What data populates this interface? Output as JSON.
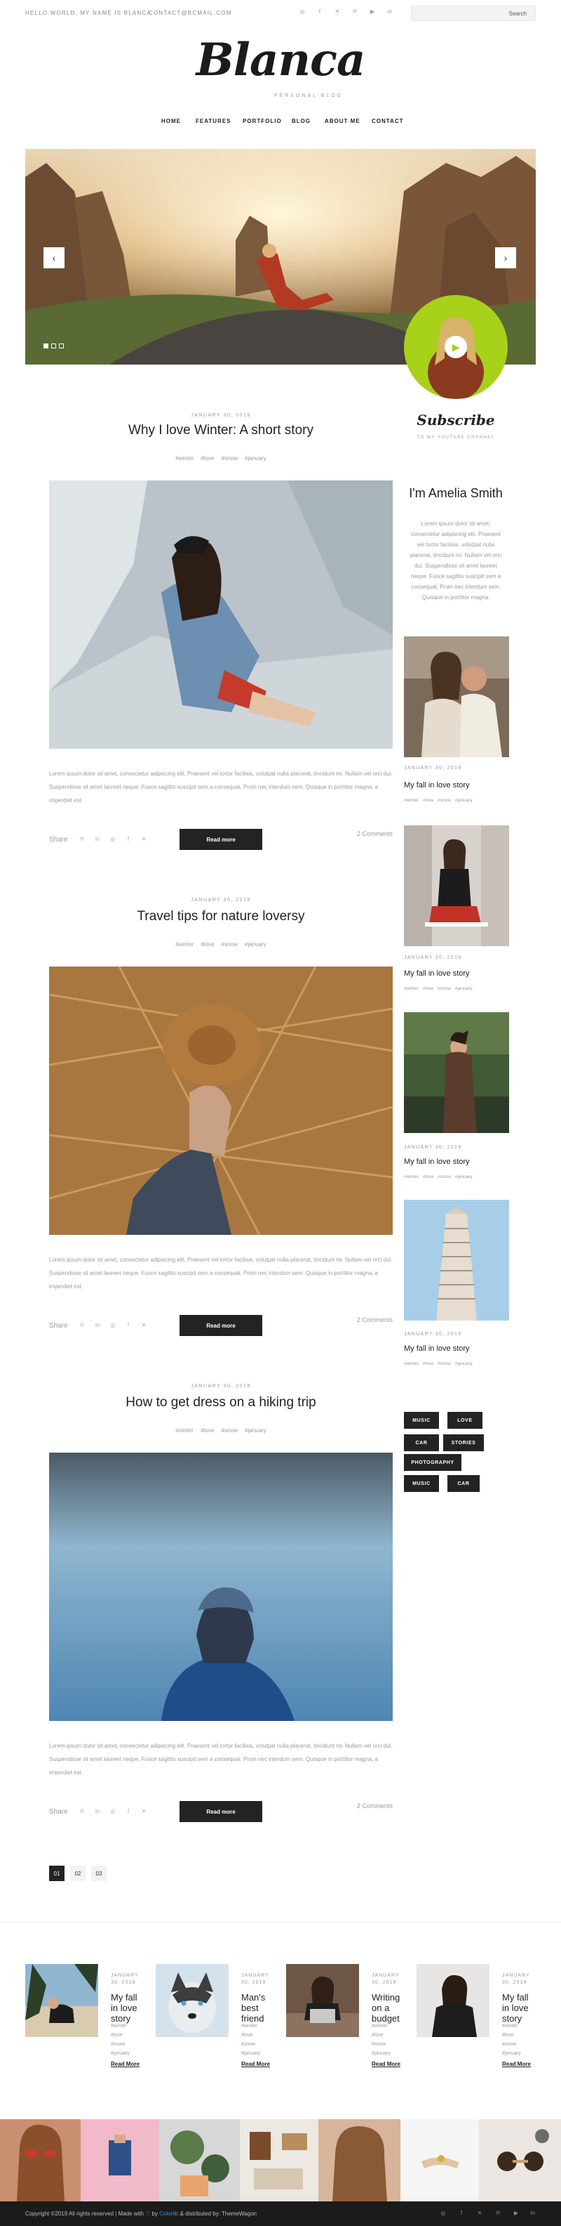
{
  "topbar": {
    "greeting": "HELLO WORLD, MY NAME IS BLANCA",
    "email": "CONTACT@BCMAIL.COM",
    "social": [
      "instagram-icon",
      "facebook-icon",
      "twitter-icon",
      "pinterest-icon",
      "youtube-icon",
      "linkedin-icon"
    ],
    "social_glyphs": [
      "◎",
      "f",
      "✕",
      "℗",
      "▶",
      "in"
    ],
    "search_placeholder": "",
    "search_label": "Search"
  },
  "header": {
    "logo": "Blanca",
    "tagline": "PERSONAL BLOG"
  },
  "nav": [
    "HOME",
    "FEATURES",
    "PORTFOLIO",
    "BLOG",
    "ABOUT ME",
    "CONTACT"
  ],
  "slider": {
    "prev": "‹",
    "next": "›",
    "dots": 3,
    "active_dot": 1
  },
  "posts": [
    {
      "date": "JANUARY 30, 2019",
      "title": "Why I love Winter: A short story",
      "tags": "#winter #love #snow #january",
      "excerpt": "Lorem ipsum dolor sit amet, consectetur adipiscing elit. Praesent vel tortor facilisis, volutpat nulla placerat, tincidunt mi. Nullam vel orci dui. Suspendisse sit amet laoreet neque. Fusce sagittis suscipit sem a consequat. Proin nec interdum sem. Quisque in porttitor magna, a imperdiet est.",
      "share": "Share",
      "read_more": "Read more",
      "comments": "2 Comments"
    },
    {
      "date": "JANUARY 30, 2019",
      "title": "Travel tips for nature loversy",
      "tags": "#winter #love #snow #january",
      "excerpt": "Lorem ipsum dolor sit amet, consectetur adipiscing elit. Praesent vel tortor facilisis, volutpat nulla placerat, tincidunt mi. Nullam vel orci dui. Suspendisse sit amet laoreet neque. Fusce sagittis suscipit sem a consequat. Proin nec interdum sem. Quisque in porttitor magna, a imperdiet est.",
      "share": "Share",
      "read_more": "Read more",
      "comments": "2 Comments"
    },
    {
      "date": "JANUARY 30, 2019",
      "title": "How to get dress on a hiking trip",
      "tags": "#winter #love #snow #january",
      "excerpt": "Lorem ipsum dolor sit amet, consectetur adipiscing elit. Praesent vel tortor facilisis, volutpat nulla placerat, tincidunt mi. Nullam vel orci dui. Suspendisse sit amet laoreet neque. Fusce sagittis suscipit sem a consequat. Proin nec interdum sem. Quisque in porttitor magna, a imperdiet est.",
      "share": "Share",
      "read_more": "Read more",
      "comments": "2 Comments"
    }
  ],
  "share_icons": [
    "pinterest-icon",
    "linkedin-icon",
    "instagram-icon",
    "facebook-icon",
    "twitter-icon"
  ],
  "share_glyphs": [
    "℗",
    "in",
    "◎",
    "f",
    "✕"
  ],
  "sidebar": {
    "subscribe": "Subscribe",
    "subscribe_sub": "TO MY YOUTUBE CHANNEL",
    "about_title": "I'm Amelia Smith",
    "about_text": "Lorem ipsum dolor sit amet, consectetur adipiscing elit. Praesent vel tortor facilisis, volutpat nulla placerat, tincidunt mi. Nullam vel orci dui. Suspendisse sit amet laoreet neque. Fusce sagittis suscipit sem a consequat. Proin nec interdum sem. Quisque in porttitor magna.",
    "posts": [
      {
        "date": "JANUARY 30, 2019",
        "title": "My fall in love story",
        "tags": "#winter #love #snow #january"
      },
      {
        "date": "JANUARY 30, 2019",
        "title": "My fall in love story",
        "tags": "#winter #love #snow #january"
      },
      {
        "date": "JANUARY 30, 2019",
        "title": "My fall in love story",
        "tags": "#winter #love #snow #january"
      },
      {
        "date": "JANUARY 30, 2019",
        "title": "My fall in love story",
        "tags": "#winter #love #snow #january"
      }
    ],
    "chips": [
      "MUSIC",
      "LOVE",
      "CAR",
      "STORIES",
      "PHOTOGRAPHY",
      "MUSIC",
      "CAR"
    ]
  },
  "pagination": [
    "01",
    "02",
    "03"
  ],
  "featured": [
    {
      "date": "JANUARY 30, 2019",
      "title": "My fall in love story",
      "tags": [
        "#winter",
        "#love",
        "#snow",
        "#january"
      ],
      "read": "Read More"
    },
    {
      "date": "JANUARY 30, 2019",
      "title": "Man's best friend",
      "tags": [
        "#winter",
        "#love",
        "#snow",
        "#january"
      ],
      "read": "Read More"
    },
    {
      "date": "JANUARY 30, 2019",
      "title": "Writing on a budget",
      "tags": [
        "#winter",
        "#love",
        "#snow",
        "#january"
      ],
      "read": "Read More"
    },
    {
      "date": "JANUARY 30, 2019",
      "title": "My fall in love story",
      "tags": [
        "#winter",
        "#love",
        "#snow",
        "#january"
      ],
      "read": "Read More"
    }
  ],
  "footer": {
    "copy_a": "Copyright ©2019 All rights reserved | Made with ♡ by ",
    "copy_b": "Colorlib",
    "copy_c": " & distributed by: ThemeWagon",
    "social": [
      "instagram-icon",
      "facebook-icon",
      "twitter-icon",
      "pinterest-icon",
      "youtube-icon",
      "linkedin-icon"
    ],
    "social_glyphs": [
      "◎",
      "f",
      "✕",
      "℗",
      "▶",
      "in"
    ]
  },
  "colors": {
    "accent_green": "#a8d11a",
    "dark": "#232323",
    "link_blue": "#3a8dde"
  }
}
